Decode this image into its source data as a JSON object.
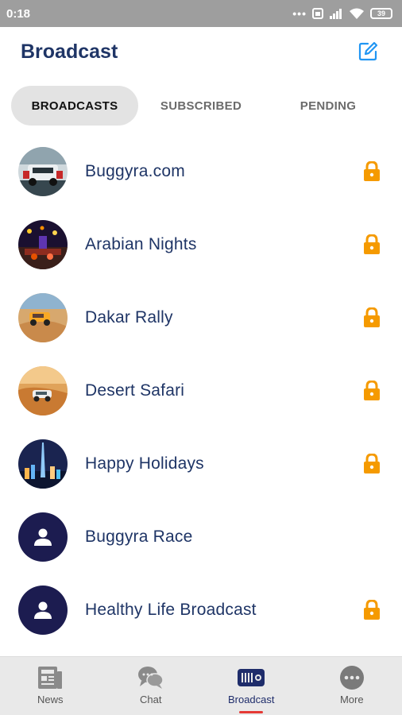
{
  "status_bar": {
    "time": "0:18",
    "battery": "39"
  },
  "header": {
    "title": "Broadcast"
  },
  "tabs": [
    {
      "label": "BROADCASTS"
    },
    {
      "label": "SUBSCRIBED"
    },
    {
      "label": "PENDING"
    }
  ],
  "broadcasts": [
    {
      "name": "Buggyra.com",
      "locked": true
    },
    {
      "name": "Arabian Nights",
      "locked": true
    },
    {
      "name": "Dakar Rally",
      "locked": true
    },
    {
      "name": "Desert Safari",
      "locked": true
    },
    {
      "name": "Happy Holidays",
      "locked": true
    },
    {
      "name": "Buggyra Race",
      "locked": false
    },
    {
      "name": "Healthy Life Broadcast",
      "locked": true
    }
  ],
  "bottom_nav": [
    {
      "label": "News",
      "icon": "news-icon"
    },
    {
      "label": "Chat",
      "icon": "chat-icon"
    },
    {
      "label": "Broadcast",
      "icon": "radio-icon"
    },
    {
      "label": "More",
      "icon": "more-icon"
    }
  ],
  "colors": {
    "accent": "#1f3566",
    "lock": "#f59a00",
    "compose": "#2196f3",
    "indicator": "#e53935",
    "avatar_placeholder": "#1c1c50"
  }
}
